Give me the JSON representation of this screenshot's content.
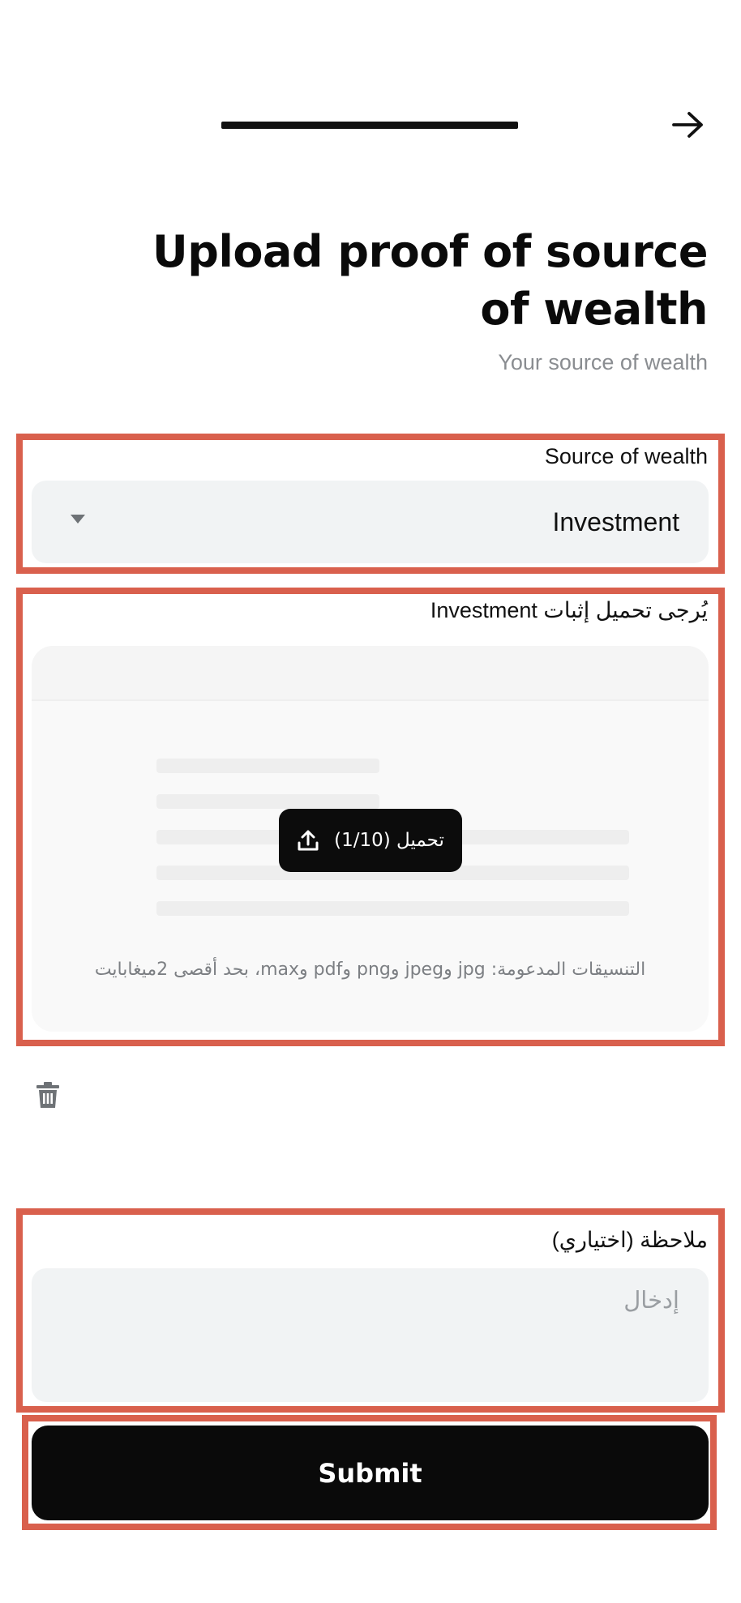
{
  "header": {
    "progress_label": "",
    "back_icon": "arrow-right-icon"
  },
  "title": "Upload proof of source of wealth",
  "subtitle": "Your source of wealth",
  "source_field": {
    "label": "Source of wealth",
    "value": "Investment",
    "caret_icon": "caret-down-icon"
  },
  "upload": {
    "label": "يُرجى تحميل إثبات Investment",
    "button_label": "تحميل (1/10)",
    "button_icon": "upload-icon",
    "formats_text": "التنسيقات المدعومة: jpg وjpeg وpng وpdf وmax، بحد أقصى 2ميغابايت"
  },
  "delete_icon": "trash-icon",
  "note": {
    "label": "ملاحظة (اختياري)",
    "placeholder": "إدخال",
    "value": ""
  },
  "submit_label": "Submit",
  "colors": {
    "highlight": "#d9604d",
    "button_bg": "#0a0a0a",
    "field_bg": "#f1f3f4",
    "muted_text": "#8a8d91"
  }
}
